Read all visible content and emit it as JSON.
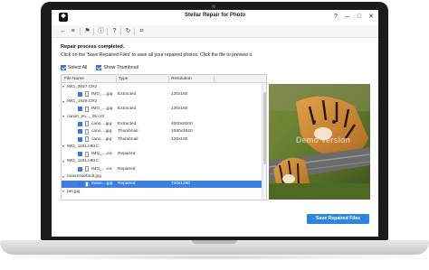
{
  "window": {
    "title": "Stellar Repair for Photo",
    "logo_glyph": "❖",
    "buttons": {
      "help": "?",
      "minimize": "–",
      "maximize": "□",
      "close": "✕"
    }
  },
  "toolbar": {
    "icons": [
      {
        "name": "back-arrow-icon",
        "glyph": "←"
      },
      {
        "name": "menu-icon",
        "glyph": "≡"
      },
      {
        "name": "bookmark-icon",
        "glyph": "⚑"
      },
      {
        "name": "info-icon",
        "glyph": "ⓘ"
      },
      {
        "name": "help-circle-icon",
        "glyph": "?"
      },
      {
        "name": "refresh-icon",
        "glyph": "↻"
      },
      {
        "name": "cart-icon",
        "glyph": "⌗"
      }
    ]
  },
  "status": {
    "heading": "Repair process completed.",
    "subtext": "Click on the 'Save Repaired Files' to save all your repaired photos. Click the file to preview it."
  },
  "options": {
    "select_all": "Select All",
    "show_thumbnail": "Show Thumbnail"
  },
  "table": {
    "columns": [
      "File Name",
      "Type",
      "Resolution"
    ],
    "rows": [
      {
        "kind": "folder",
        "name": "IMG_0027.CR2"
      },
      {
        "kind": "file",
        "name": "IMG_....jpg",
        "type": "Extracted",
        "resolution": "120x160"
      },
      {
        "kind": "folder",
        "name": "IMG_1929.CR2"
      },
      {
        "kind": "file",
        "name": "IMG_....jpg",
        "type": "Extracted",
        "resolution": "120x160"
      },
      {
        "kind": "folder",
        "name": "canon_eo..._05.cr3"
      },
      {
        "kind": "file",
        "name": "cano....jpg",
        "type": "Extracted",
        "resolution": "4000x6000"
      },
      {
        "kind": "file",
        "name": "cano....jpg",
        "type": "Thumbnail",
        "resolution": "1080x1620"
      },
      {
        "kind": "file",
        "name": "cano....jpg",
        "type": "Thumbnail",
        "resolution": "120x160"
      },
      {
        "kind": "folder",
        "name": "IMG_1191.HEIC"
      },
      {
        "kind": "file",
        "name": "IMG_....eic",
        "type": "Repaired",
        "resolution": ""
      },
      {
        "kind": "folder",
        "name": "IMG_1191.HEIC"
      },
      {
        "kind": "file",
        "name": "IMG_....eic",
        "type": "Repaired",
        "resolution": ""
      },
      {
        "kind": "folder",
        "name": "maxresdefault.jpg"
      },
      {
        "kind": "file",
        "name": "maxe....jpg",
        "type": "Repaired",
        "resolution": "720x1280",
        "selected": true
      },
      {
        "kind": "folder",
        "name": "pet.jpg"
      }
    ]
  },
  "preview": {
    "watermark": "Demo Version"
  },
  "actions": {
    "save_label": "Save Repaired Files"
  },
  "colors": {
    "accent": "#2e86de",
    "selection": "#3d7fe0"
  }
}
